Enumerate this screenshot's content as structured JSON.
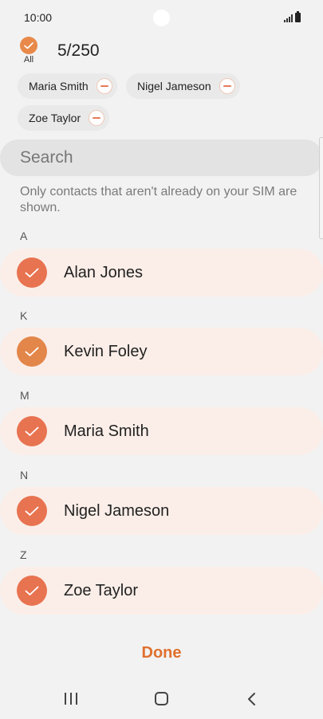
{
  "status_bar": {
    "time": "10:00"
  },
  "header": {
    "select_all_label": "All",
    "count": "5/250"
  },
  "selected_chips": [
    {
      "label": "Maria Smith"
    },
    {
      "label": "Nigel Jameson"
    },
    {
      "label": "Zoe Taylor"
    }
  ],
  "search": {
    "placeholder": "Search",
    "value": ""
  },
  "info_text": "Only contacts that aren't already on your SIM are shown.",
  "sections": [
    {
      "letter": "A",
      "contact": "Alan Jones",
      "checked": true
    },
    {
      "letter": "K",
      "contact": "Kevin Foley",
      "checked": true
    },
    {
      "letter": "M",
      "contact": "Maria Smith",
      "checked": true
    },
    {
      "letter": "N",
      "contact": "Nigel Jameson",
      "checked": true
    },
    {
      "letter": "Z",
      "contact": "Zoe Taylor",
      "checked": true
    }
  ],
  "done_label": "Done",
  "colors": {
    "accent": "#e0702f",
    "check": "#e87350",
    "row_bg": "#fbeee8"
  },
  "icons": {
    "select_all": "check-circle-icon",
    "chip_remove": "minus-circle-icon",
    "contact_check": "check-circle-icon",
    "nav": [
      "recent-apps-icon",
      "home-icon",
      "back-icon"
    ]
  }
}
